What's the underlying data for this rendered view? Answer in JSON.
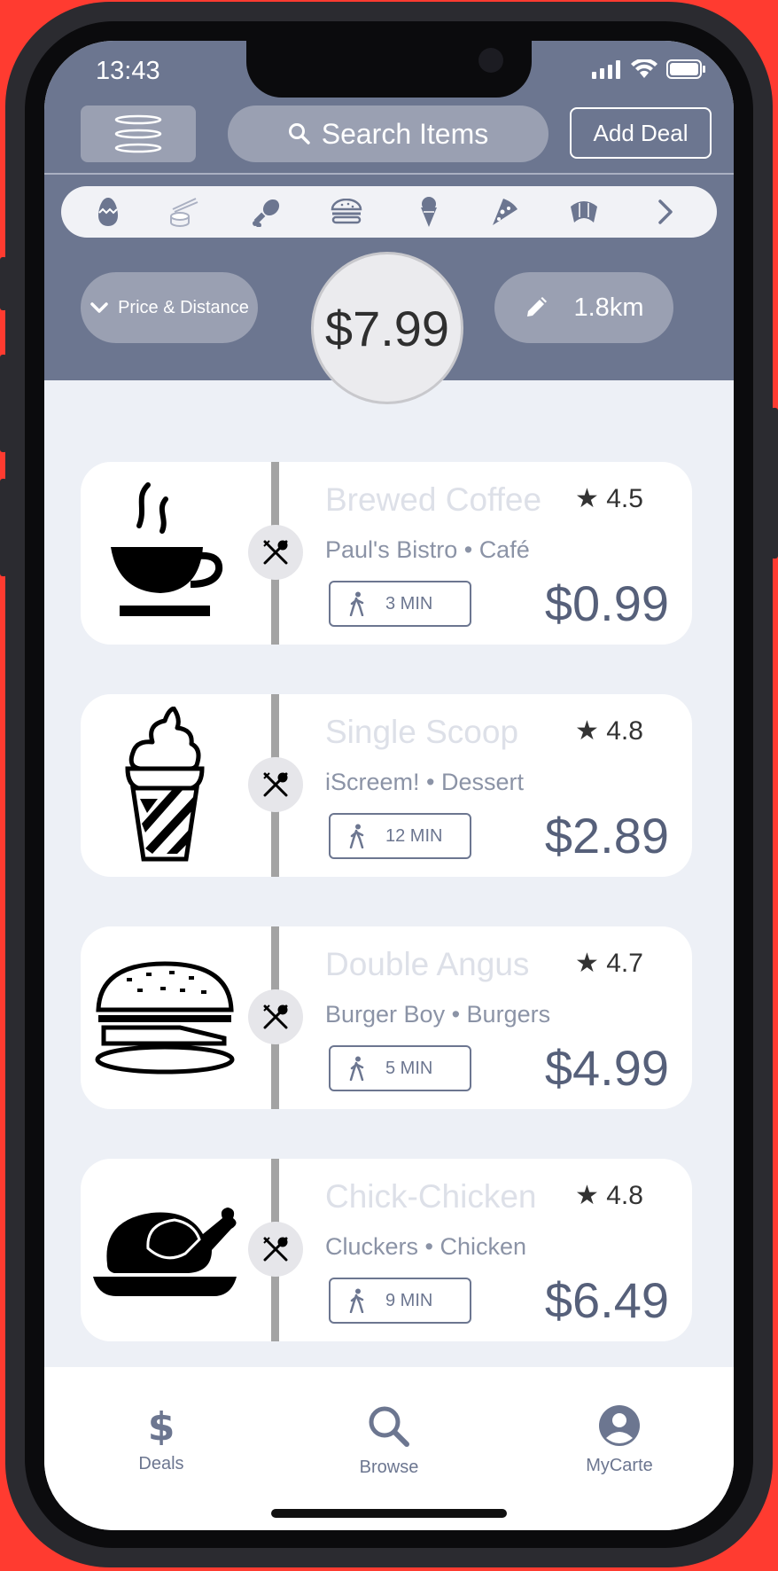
{
  "status_bar": {
    "time": "13:43"
  },
  "header": {
    "search_label": "Search Items",
    "add_deal_label": "Add Deal"
  },
  "categories": [
    "egg-icon",
    "sushi-icon",
    "drumstick-icon",
    "burger-icon",
    "ice-cream-icon",
    "pizza-icon",
    "croissant-icon"
  ],
  "filters": {
    "sort_label": "Price & Distance",
    "max_price": "$7.99",
    "distance": "1.8km"
  },
  "deals": [
    {
      "name": "Brewed Coffee",
      "rating": "4.5",
      "restaurant": "Paul's Bistro",
      "category": "Café",
      "walk_time": "3 MIN",
      "price": "$0.99",
      "icon": "coffee-icon"
    },
    {
      "name": "Single Scoop",
      "rating": "4.8",
      "restaurant": "iScreem!",
      "category": "Dessert",
      "walk_time": "12 MIN",
      "price": "$2.89",
      "icon": "ice-cream-cone-icon"
    },
    {
      "name": "Double Angus",
      "rating": "4.7",
      "restaurant": "Burger Boy",
      "category": "Burgers",
      "walk_time": "5 MIN",
      "price": "$4.99",
      "icon": "burger-icon"
    },
    {
      "name": "Chick-Chicken",
      "rating": "4.8",
      "restaurant": "Cluckers",
      "category": "Chicken",
      "walk_time": "9 MIN",
      "price": "$6.49",
      "icon": "roast-chicken-icon"
    }
  ],
  "tabbar": {
    "deals_label": "Deals",
    "browse_label": "Browse",
    "mycarte_label": "MyCarte"
  },
  "colors": {
    "header_bg": "#6c7690",
    "pill_bg": "#9aa0b2",
    "screen_bg": "#edf0f6",
    "price_text": "#56607a",
    "frame": "#2b2b30",
    "outer_bg": "#ff3b30"
  }
}
